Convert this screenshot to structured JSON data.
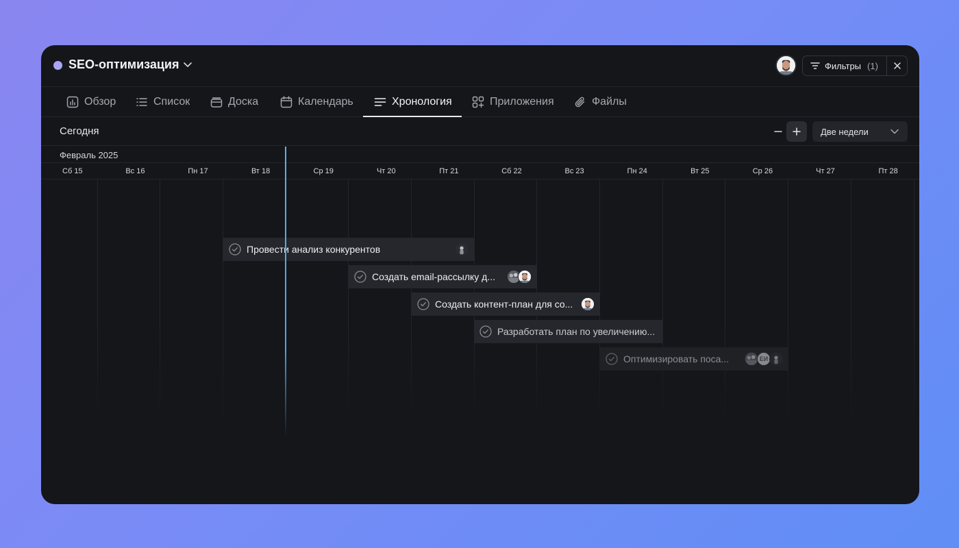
{
  "project": {
    "name": "SEO-оптимизация",
    "dot_color": "#a9a6f5"
  },
  "header": {
    "filters_label": "Фильтры",
    "filters_count": "(1)"
  },
  "tabs": [
    {
      "label": "Обзор",
      "icon": "chart-icon"
    },
    {
      "label": "Список",
      "icon": "list-icon"
    },
    {
      "label": "Доска",
      "icon": "board-icon"
    },
    {
      "label": "Календарь",
      "icon": "calendar-icon"
    },
    {
      "label": "Хронология",
      "icon": "timeline-icon",
      "active": true
    },
    {
      "label": "Приложения",
      "icon": "apps-icon"
    },
    {
      "label": "Файлы",
      "icon": "paperclip-icon"
    }
  ],
  "toolbar": {
    "today_label": "Сегодня",
    "range_value": "Две недели"
  },
  "timeline": {
    "month": "Февраль 2025",
    "days": [
      "Сб 15",
      "Вс 16",
      "Пн 17",
      "Вт 18",
      "Ср 19",
      "Чт 20",
      "Пт 21",
      "Сб 22",
      "Вс 23",
      "Пн 24",
      "Вт 25",
      "Ср 26",
      "Чт 27",
      "Пт 28"
    ],
    "current_marker_color": "#4aa6e0"
  },
  "tasks": [
    {
      "name": "Провести анализ конкурентов",
      "assignees": [
        "silhouette"
      ]
    },
    {
      "name": "Создать email-рассылку д...",
      "assignees": [
        "group-photo",
        "bearded-man"
      ]
    },
    {
      "name": "Создать контент-план для со...",
      "assignees": [
        "bearded-man"
      ]
    },
    {
      "name": "Разработать план по увеличению...",
      "assignees": []
    },
    {
      "name": "Оптимизировать поса...",
      "assignees": [
        "group-photo",
        "initials",
        "silhouette"
      ],
      "initials": "ЕИ"
    }
  ]
}
